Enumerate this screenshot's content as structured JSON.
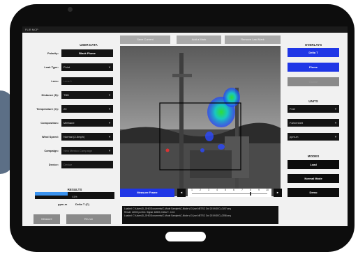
{
  "app": {
    "title": "FLIR MCP"
  },
  "user_data": {
    "header": "USER DATA",
    "fields": [
      {
        "label": "Polarity:",
        "value": "Black Plume"
      },
      {
        "label": "Leak Type:",
        "value": "Point"
      },
      {
        "label": "Lens:",
        "value": "Lens 1"
      },
      {
        "label": "Distance (ft):",
        "value": "TBD"
      },
      {
        "label": "Temperature (C):",
        "value": "20"
      },
      {
        "label": "Composition:",
        "value": "Methane"
      },
      {
        "label": "Wind Speed:",
        "value": "Normal (2-5mph)"
      },
      {
        "label": "Campaign:",
        "value": "New Mexico Campaign"
      },
      {
        "label": "Device:",
        "value": "Device"
      }
    ]
  },
  "results": {
    "header": "RESULTS",
    "progress_text": "41%",
    "progress": 0.41,
    "units": [
      "ppm-m",
      "Delta T (C)"
    ]
  },
  "bottom_buttons": {
    "left": "Measure",
    "right": "Re-run"
  },
  "tabs": [
    "Save Current",
    "Add a Mark",
    "Remove Last Mark"
  ],
  "overlays": {
    "header": "OVERLAYS",
    "buttons": [
      "Delta T",
      "Plume",
      "Outline"
    ]
  },
  "units_panel": {
    "header": "UNITS",
    "selects": [
      "Feet",
      "Fahrenheit",
      "ppm-m"
    ]
  },
  "modes": {
    "header": "MODES",
    "buttons": [
      "Load",
      "Normal Mode",
      "Demo"
    ]
  },
  "playback": {
    "button": "Measure Frame",
    "prev": "◄",
    "next": "►",
    "ticks": [
      "1",
      "2",
      "3",
      "4",
      "5",
      "6",
      "7",
      "8",
      "9",
      "10"
    ],
    "position": 8
  },
  "log": {
    "lines": [
      "Loaded: C:\\Users\\D_GHG\\Documents\\C-Mode Samples\\C-Mode v13 (run NETSC  Oct 2019\\GEO_0157.seq",
      "Result: 12000 pct frm: Signal: 18503, Delta T: -13.6",
      "Loaded: C:\\Users\\D_GHG\\Documents\\C-Mode Samples\\C-Mode v13 (run NETSC  Oct 2019\\GEO_0258.seq"
    ]
  },
  "colors": {
    "bezel": "#0d0d0d",
    "accent_blue": "#1f36e6",
    "progress_fill": "#3a93f0",
    "field_bg": "#141414"
  }
}
